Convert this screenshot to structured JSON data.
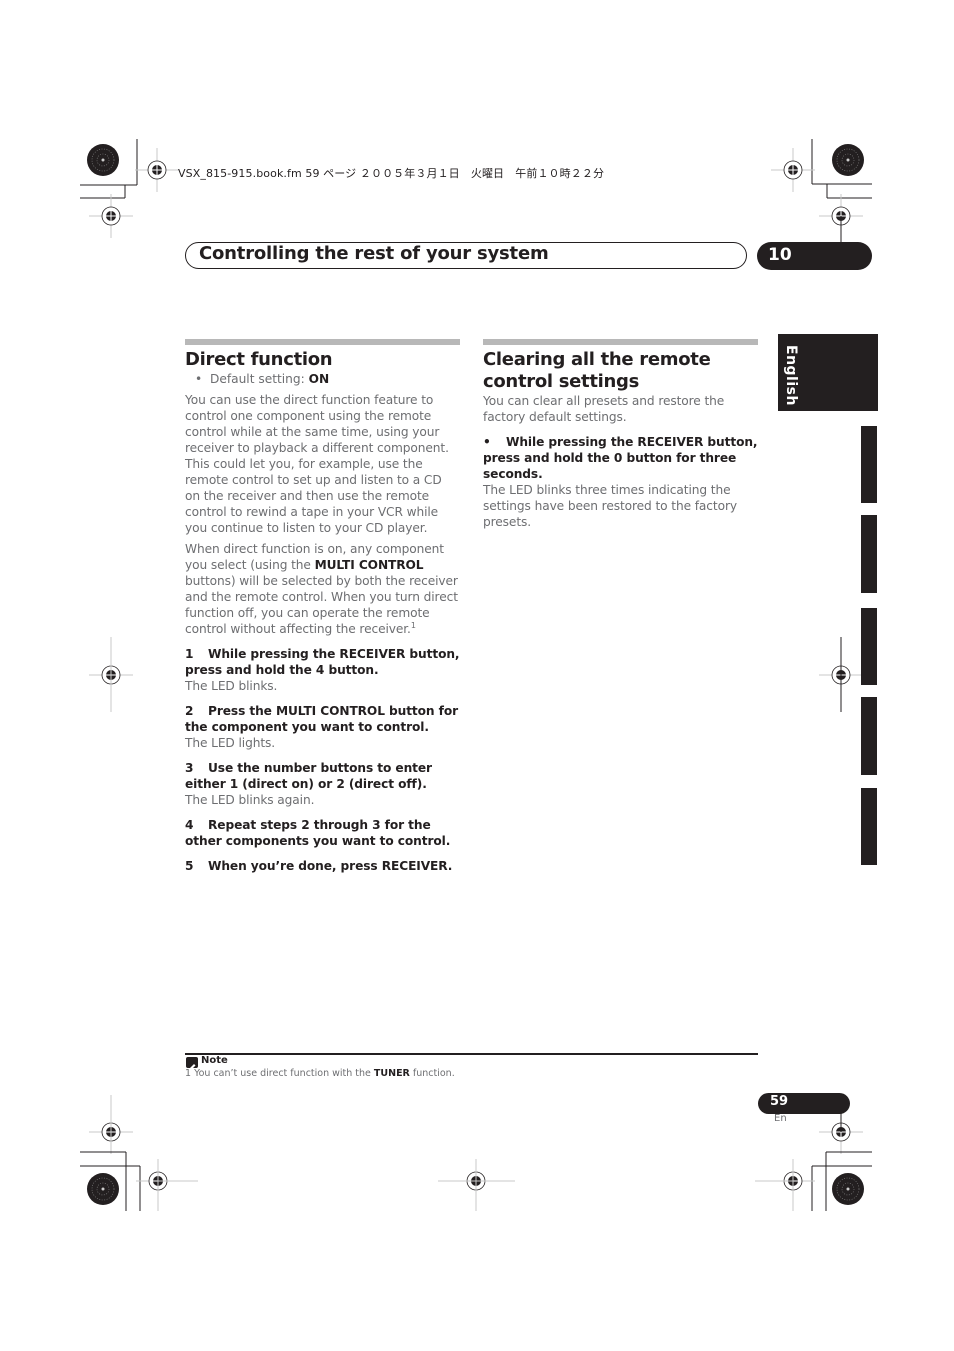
{
  "proof_header": {
    "text": "VSX_815-915.book.fm  59 ページ  ２００５年３月１日　火曜日　午前１０時２２分"
  },
  "chapter": {
    "title": "Controlling the rest of your system",
    "number": "10"
  },
  "language_tab": {
    "label": "English"
  },
  "left_column": {
    "heading": "Direct function",
    "default_setting_label": "Default setting: ",
    "default_setting_value": "ON",
    "intro": "You can use the direct function feature to control one component using the remote control while at the same time, using your receiver to playback a different component. This could let you, for example, use the remote control to set up and listen to a CD on the receiver and then use the remote control to rewind a tape in your VCR while you continue to listen to your CD player.",
    "para2_part1": "When direct function is on, any component you select (using the ",
    "para2_bold": "MULTI CONTROL",
    "para2_part2": " buttons) will be selected by both the receiver and the remote control. When you turn direct function off, you can operate the remote control without affecting the receiver.",
    "para2_footnote_ref": "1",
    "steps": [
      {
        "num": "1",
        "text": "While pressing the RECEIVER button, press and hold the 4 button.",
        "result": "The LED blinks."
      },
      {
        "num": "2",
        "text": "Press the MULTI CONTROL button for the component you want to control.",
        "result": "The LED lights."
      },
      {
        "num": "3",
        "text": "Use the number buttons to enter either 1 (direct on) or 2 (direct off).",
        "result": "The LED blinks again."
      },
      {
        "num": "4",
        "text": "Repeat steps 2 through 3 for the other components you want to control.",
        "result": ""
      },
      {
        "num": "5",
        "text": "When you’re done, press RECEIVER.",
        "result": ""
      }
    ]
  },
  "right_column": {
    "heading": "Clearing all the remote control settings",
    "intro": "You can clear all presets and restore the factory default settings.",
    "step_bullet": "•",
    "step_text": "While pressing the RECEIVER button, press and hold the 0 button for three seconds.",
    "result": "The LED blinks three times indicating the settings have been restored to the factory presets."
  },
  "footnote": {
    "label": "Note",
    "num": "1",
    "text_part1": " You can’t use direct function with the ",
    "text_bold": "TUNER",
    "text_part2": " function."
  },
  "page": {
    "number": "59",
    "lang": "En"
  }
}
